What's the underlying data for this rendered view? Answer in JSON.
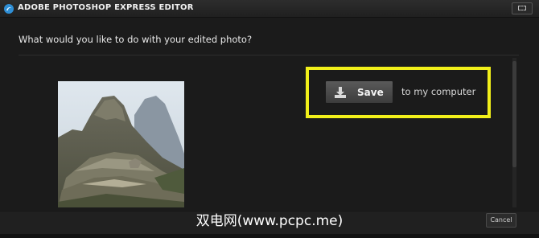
{
  "window": {
    "title": "ADOBE PHOTOSHOP EXPRESS EDITOR",
    "logo_icon": "photoshop-express-logo-icon",
    "restore_icon": "window-restore-icon"
  },
  "dialog": {
    "question": "What would you like to do with your edited photo?",
    "save_button_label": "Save",
    "save_icon": "download-arrow-icon",
    "save_destination": "to my computer",
    "highlight_color": "#f2f01a"
  },
  "footer": {
    "cancel_label": "Cancel",
    "watermark": "双电网(www.pcpc.me)"
  },
  "colors": {
    "background": "#1c1c1c",
    "button": "#4a4a4a"
  }
}
